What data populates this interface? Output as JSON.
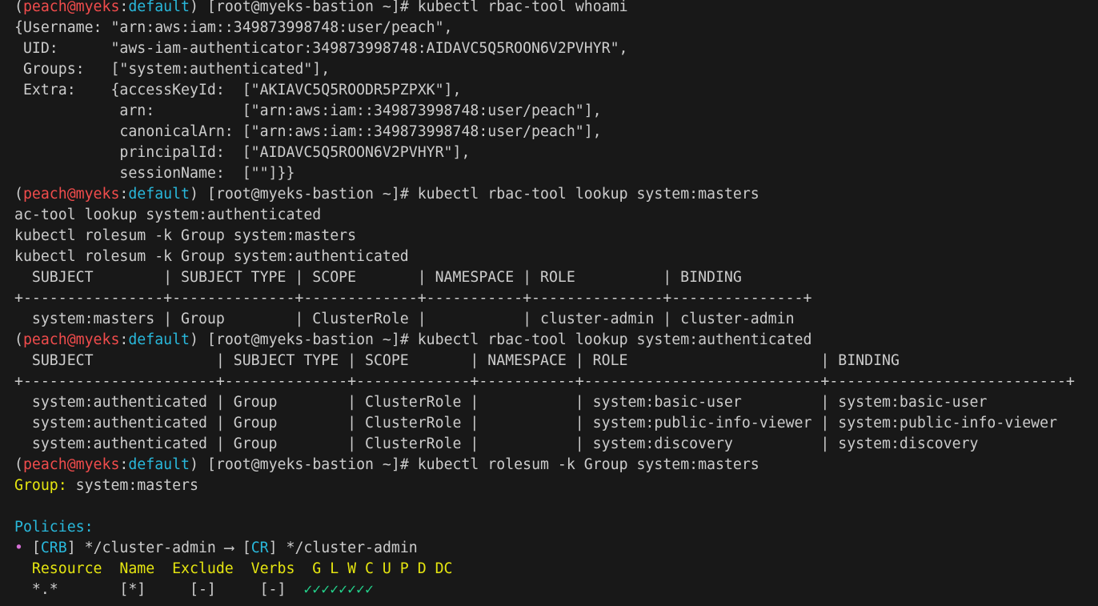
{
  "prompt": {
    "open": "(",
    "user": "peach",
    "at": "@",
    "cluster": "myeks",
    "colon": ":",
    "namespace": "default",
    "close": ")",
    "shell": " [root@myeks-bastion ~]# "
  },
  "cmd_whoami": "kubectl rbac-tool whoami",
  "whoami_output": [
    "{Username: \"arn:aws:iam::349873998748:user/peach\",",
    " UID:      \"aws-iam-authenticator:349873998748:AIDAVC5Q5ROON6V2PVHYR\",",
    " Groups:   [\"system:authenticated\"],",
    " Extra:    {accessKeyId:  [\"AKIAVC5Q5ROODR5PZPXK\"],",
    "            arn:          [\"arn:aws:iam::349873998748:user/peach\"],",
    "            canonicalArn: [\"arn:aws:iam::349873998748:user/peach\"],",
    "            principalId:  [\"AIDAVC5Q5ROON6V2PVHYR\"],",
    "            sessionName:  [\"\"]}}"
  ],
  "cmd_lookup_masters": "kubectl rbac-tool lookup system:masters",
  "pasted_lines": [
    "ac-tool lookup system:authenticated",
    "kubectl rolesum -k Group system:masters",
    "kubectl rolesum -k Group system:authenticated"
  ],
  "masters_table": [
    "  SUBJECT        | SUBJECT TYPE | SCOPE       | NAMESPACE | ROLE          | BINDING",
    "+----------------+--------------+-------------+-----------+---------------+---------------+",
    "  system:masters | Group        | ClusterRole |           | cluster-admin | cluster-admin"
  ],
  "cmd_lookup_authenticated": "kubectl rbac-tool lookup system:authenticated",
  "authenticated_table": [
    "  SUBJECT              | SUBJECT TYPE | SCOPE       | NAMESPACE | ROLE                      | BINDING",
    "+----------------------+--------------+-------------+-----------+---------------------------+---------------------------+",
    "  system:authenticated | Group        | ClusterRole |           | system:basic-user         | system:basic-user",
    "  system:authenticated | Group        | ClusterRole |           | system:public-info-viewer | system:public-info-viewer",
    "  system:authenticated | Group        | ClusterRole |           | system:discovery          | system:discovery"
  ],
  "cmd_rolesum": "kubectl rolesum -k Group system:masters",
  "rolesum": {
    "group_label": "Group:",
    "group_value": " system:masters",
    "policies_label": "Policies:",
    "bullet": "•",
    "crb_open": " [",
    "crb_tag": "CRB",
    "crb_close": "] */cluster-admin ",
    "arrow": "⟶",
    "cr_open": " [",
    "cr_tag": "CR",
    "cr_close": "] */cluster-admin",
    "header": "  Resource  Name  Exclude  Verbs  G L W C U P D DC",
    "row_prefix": "  *.*       [*]     [-]     [-]  ",
    "row_checks": "✓✓✓✓✓✓✓✓"
  },
  "colors": {
    "background": "#181818",
    "foreground": "#cccccc",
    "red": "#f14c4c",
    "blue": "#29b8db",
    "yellow": "#e5e510",
    "magenta": "#d670d6",
    "green": "#23d18b"
  }
}
